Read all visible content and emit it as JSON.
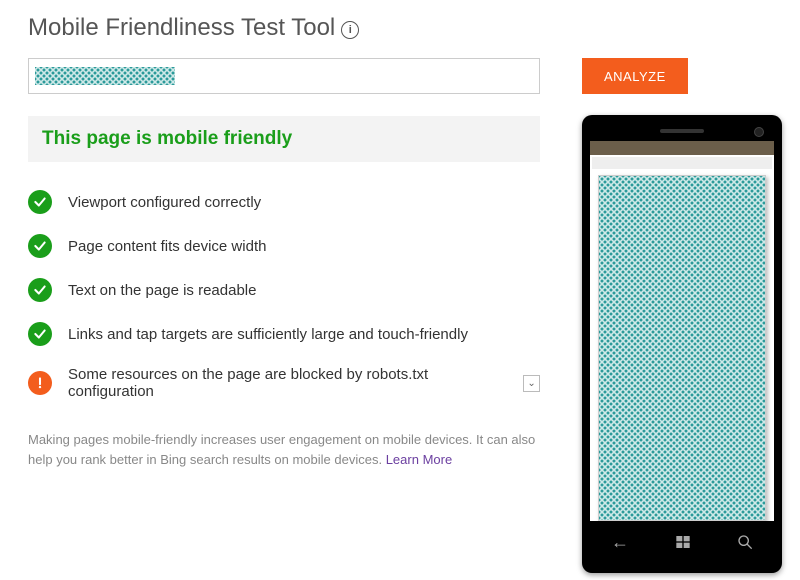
{
  "header": {
    "title": "Mobile Friendliness Test Tool",
    "info_glyph": "i"
  },
  "input": {
    "placeholder": ""
  },
  "buttons": {
    "analyze": "ANALYZE"
  },
  "result": {
    "headline": "This page is mobile friendly"
  },
  "checks": [
    {
      "status": "ok",
      "text": "Viewport configured correctly"
    },
    {
      "status": "ok",
      "text": "Page content fits device width"
    },
    {
      "status": "ok",
      "text": "Text on the page is readable"
    },
    {
      "status": "ok",
      "text": "Links and tap targets are sufficiently large and touch-friendly"
    },
    {
      "status": "warn",
      "text": "Some resources on the page are blocked by robots.txt configuration",
      "expandable": true
    }
  ],
  "footer": {
    "text": "Making pages mobile-friendly increases user engagement on mobile devices. It can also help you rank better in Bing search results on mobile devices. ",
    "link": "Learn More"
  },
  "colors": {
    "accent": "#f35d1d",
    "success": "#1a9e1a"
  }
}
